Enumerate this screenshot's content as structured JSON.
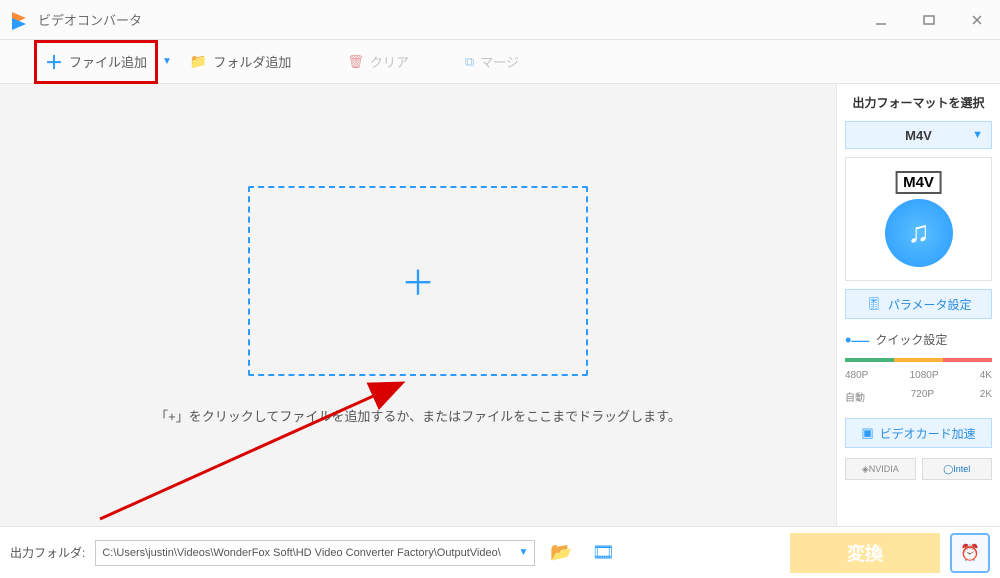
{
  "app": {
    "title": "ビデオコンバータ"
  },
  "toolbar": {
    "add_file": "ファイル追加",
    "add_folder": "フォルダ追加",
    "clear": "クリア",
    "merge": "マージ"
  },
  "dropzone": {
    "hint": "「+」をクリックしてファイルを追加するか、またはファイルをここまでドラッグします。"
  },
  "sidebar": {
    "title": "出力フォーマットを選択",
    "format": "M4V",
    "format_icon_label": "M4V",
    "param_btn": "パラメータ設定",
    "quick_label": "クイック設定",
    "res_top": {
      "a": "480P",
      "b": "1080P",
      "c": "4K"
    },
    "res_bottom": {
      "a": "自動",
      "b": "720P",
      "c": "2K"
    },
    "gpu_btn": "ビデオカード加速",
    "gpu": {
      "nvidia": "NVIDIA",
      "intel": "Intel"
    }
  },
  "bottom": {
    "out_label": "出力フォルダ:",
    "out_path": "C:\\Users\\justin\\Videos\\WonderFox Soft\\HD Video Converter Factory\\OutputVideo\\",
    "convert": "変換"
  }
}
